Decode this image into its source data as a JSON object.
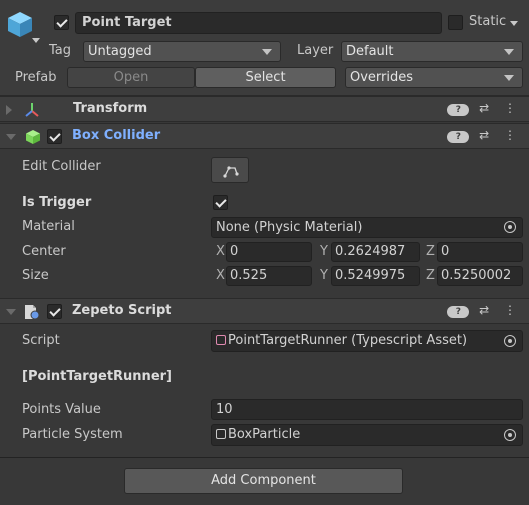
{
  "object": {
    "name": "Point Target",
    "active": true,
    "static_label": "Static",
    "static": false,
    "tag_label": "Tag",
    "tag_value": "Untagged",
    "layer_label": "Layer",
    "layer_value": "Default",
    "prefab_label": "Prefab",
    "prefab_open": "Open",
    "prefab_select": "Select",
    "prefab_overrides": "Overrides"
  },
  "transform": {
    "title": "Transform"
  },
  "box_collider": {
    "title": "Box Collider",
    "enabled": true,
    "edit_collider_label": "Edit Collider",
    "is_trigger_label": "Is Trigger",
    "is_trigger": true,
    "material_label": "Material",
    "material_value": "None (Physic Material)",
    "center_label": "Center",
    "center": {
      "x": "0",
      "y": "0.2624987",
      "z": "0"
    },
    "size_label": "Size",
    "size": {
      "x": "0.525",
      "y": "0.5249975",
      "z": "0.5250002"
    },
    "axis_x": "X",
    "axis_y": "Y",
    "axis_z": "Z"
  },
  "zepeto_script": {
    "title": "Zepeto Script",
    "enabled": true,
    "script_label": "Script",
    "script_value": "PointTargetRunner (Typescript Asset)",
    "section_title": "[PointTargetRunner]",
    "points_label": "Points Value",
    "points_value": "10",
    "particle_label": "Particle System",
    "particle_value": "BoxParticle"
  },
  "add_component_label": "Add Component",
  "colors": {
    "background": "#383838",
    "header": "#3e3e3e",
    "field": "#2a2a2a",
    "accent_title": "#7fb0ff",
    "selected_button": "#5f5f5f"
  }
}
